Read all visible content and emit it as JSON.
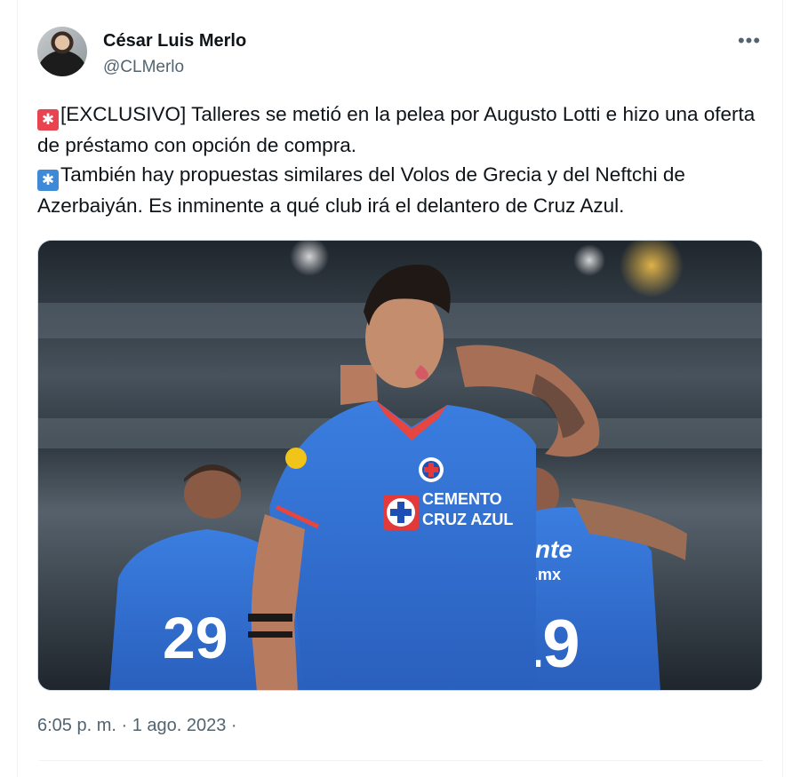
{
  "author": {
    "name": "César Luis Merlo",
    "handle": "@CLMerlo"
  },
  "tweet": {
    "line1_emoji": "siren-emoji",
    "line1": "[EXCLUSIVO] Talleres se metió en la pelea por Augusto Lotti e hizo una oferta de préstamo con opción de compra.",
    "line2_emoji": "asterisk-emoji",
    "line2": "También hay propuestas similares del Volos de Grecia y del Neftchi de Azerbaiyán. Es inminente a qué club irá el delantero de Cruz Azul."
  },
  "photo": {
    "sponsor_line1": "CEMENTO",
    "sponsor_line2": "CRUZ AZUL",
    "player_left_number": "29",
    "player_right_number": "19",
    "player_right_text": "viente",
    "player_right_text2": "ente.mx"
  },
  "meta": {
    "timestamp": "6:05 p. m. · 1 ago. 2023 ·"
  },
  "colors": {
    "text": "#0f1419",
    "secondary": "#536471",
    "jersey_blue": "#2f6fd6"
  }
}
